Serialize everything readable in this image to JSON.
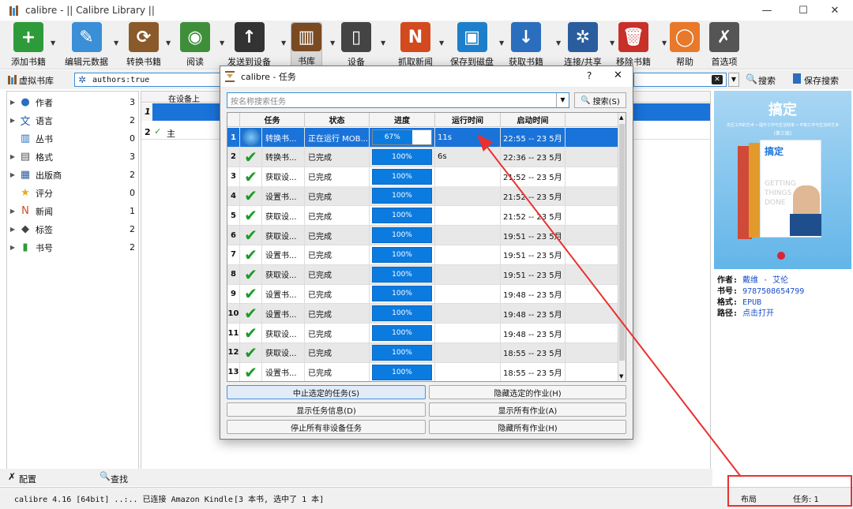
{
  "window": {
    "title": "calibre - || Calibre Library ||",
    "minimize": "—",
    "maximize": "☐",
    "close": "✕"
  },
  "toolbar": {
    "buttons": [
      {
        "label": "添加书籍",
        "color": "#2e9b3a",
        "glyph": "+"
      },
      {
        "label": "编辑元数据",
        "color": "#3a8fd6",
        "glyph": "✎"
      },
      {
        "label": "转换书籍",
        "color": "#8b5a2b",
        "glyph": "⟳"
      },
      {
        "label": "阅读",
        "color": "#3f8f3a",
        "glyph": "◉"
      },
      {
        "label": "发送到设备",
        "color": "#333333",
        "glyph": "↑"
      },
      {
        "label": "书库",
        "color": "#7a4a22",
        "glyph": "▥"
      },
      {
        "label": "设备",
        "color": "#444444",
        "glyph": "▯"
      },
      {
        "label": "抓取新闻",
        "color": "#d24a1d",
        "glyph": "N"
      },
      {
        "label": "保存到磁盘",
        "color": "#1d7fc9",
        "glyph": "▣"
      },
      {
        "label": "获取书籍",
        "color": "#2a6ebd",
        "glyph": "↓"
      },
      {
        "label": "连接/共享",
        "color": "#2a5d9e",
        "glyph": "✲"
      },
      {
        "label": "移除书籍",
        "color": "#c8302a",
        "glyph": "🗑"
      },
      {
        "label": "帮助",
        "color": "#e8782a",
        "glyph": "◯"
      },
      {
        "label": "首选项",
        "color": "#555555",
        "glyph": "✗"
      }
    ]
  },
  "searchbar": {
    "virtual_library": "虚拟书库",
    "query": "authors:true",
    "search_label": "搜索",
    "saved_search_label": "保存搜索"
  },
  "tag_browser": {
    "items": [
      {
        "label": "作者",
        "count": "3",
        "icon": "person-icon"
      },
      {
        "label": "语言",
        "count": "2",
        "icon": "language-icon"
      },
      {
        "label": "丛书",
        "count": "0",
        "icon": "series-icon"
      },
      {
        "label": "格式",
        "count": "3",
        "icon": "format-icon"
      },
      {
        "label": "出版商",
        "count": "2",
        "icon": "publisher-icon"
      },
      {
        "label": "评分",
        "count": "0",
        "icon": "star-icon"
      },
      {
        "label": "新闻",
        "count": "1",
        "icon": "news-icon"
      },
      {
        "label": "标签",
        "count": "2",
        "icon": "tag-icon"
      },
      {
        "label": "书号",
        "count": "2",
        "icon": "barcode-icon"
      }
    ],
    "configure": "配置",
    "find": "查找"
  },
  "library": {
    "col_ondevice": "在设备上",
    "row1": "1",
    "row2": "2",
    "row2_mark": "✓",
    "row2_text": "主"
  },
  "book_details": {
    "cover_title": "搞定",
    "cover_subtitle": "无压工作的艺术 • 提升工作与生活效率 • 平衡工作与生活的艺术",
    "cover_vol": "(第三版)",
    "cover_text": "GETTING THINGS DONE",
    "author_label": "作者:",
    "author": "戴维 · 艾伦",
    "isbn_label": "书号:",
    "isbn": "9787508654799",
    "format_label": "格式:",
    "format": "EPUB",
    "path_label": "路径:",
    "path": "点击打开"
  },
  "status": {
    "left": "calibre 4.16 [64bit] ..:.. 已连接 Amazon Kindle",
    "center": "[3 本书, 选中了 1 本]",
    "layout": "布局",
    "jobs": "任务: 1"
  },
  "jobs_dialog": {
    "title": "calibre - 任务",
    "help": "?",
    "search_placeholder": "按名称搜索任务",
    "search_button": "搜索(S)",
    "columns": [
      "任务",
      "状态",
      "进度",
      "运行时间",
      "启动时间"
    ],
    "rows": [
      {
        "n": "1",
        "task": "转换书...",
        "status": "正在运行 MOB...",
        "progress": "67%",
        "progress_value": 0.67,
        "runtime": "11s",
        "start": "22:55 -- 23 5月"
      },
      {
        "n": "2",
        "task": "转换书...",
        "status": "已完成",
        "progress": "100%",
        "runtime": "6s",
        "start": "22:36 -- 23 5月"
      },
      {
        "n": "3",
        "task": "获取设...",
        "status": "已完成",
        "progress": "100%",
        "runtime": "",
        "start": "21:52 -- 23 5月"
      },
      {
        "n": "4",
        "task": "设置书...",
        "status": "已完成",
        "progress": "100%",
        "runtime": "",
        "start": "21:52 -- 23 5月"
      },
      {
        "n": "5",
        "task": "获取设...",
        "status": "已完成",
        "progress": "100%",
        "runtime": "",
        "start": "21:52 -- 23 5月"
      },
      {
        "n": "6",
        "task": "获取设...",
        "status": "已完成",
        "progress": "100%",
        "runtime": "",
        "start": "19:51 -- 23 5月"
      },
      {
        "n": "7",
        "task": "设置书...",
        "status": "已完成",
        "progress": "100%",
        "runtime": "",
        "start": "19:51 -- 23 5月"
      },
      {
        "n": "8",
        "task": "获取设...",
        "status": "已完成",
        "progress": "100%",
        "runtime": "",
        "start": "19:51 -- 23 5月"
      },
      {
        "n": "9",
        "task": "设置书...",
        "status": "已完成",
        "progress": "100%",
        "runtime": "",
        "start": "19:48 -- 23 5月"
      },
      {
        "n": "10",
        "task": "设置书...",
        "status": "已完成",
        "progress": "100%",
        "runtime": "",
        "start": "19:48 -- 23 5月"
      },
      {
        "n": "11",
        "task": "获取设...",
        "status": "已完成",
        "progress": "100%",
        "runtime": "",
        "start": "19:48 -- 23 5月"
      },
      {
        "n": "12",
        "task": "获取设...",
        "status": "已完成",
        "progress": "100%",
        "runtime": "",
        "start": "18:55 -- 23 5月"
      },
      {
        "n": "13",
        "task": "设置书...",
        "status": "已完成",
        "progress": "100%",
        "runtime": "",
        "start": "18:55 -- 23 5月"
      }
    ],
    "buttons": {
      "stop_selected": "中止选定的任务(S)",
      "hide_selected": "隐藏选定的作业(H)",
      "show_info": "显示任务信息(D)",
      "show_all": "显示所有作业(A)",
      "stop_non_device": "停止所有非设备任务",
      "hide_all": "隐藏所有作业(H)"
    }
  },
  "colors": {
    "accent": "#1a73d9",
    "progress": "#0b7be0",
    "annotation": "#e8312f"
  }
}
